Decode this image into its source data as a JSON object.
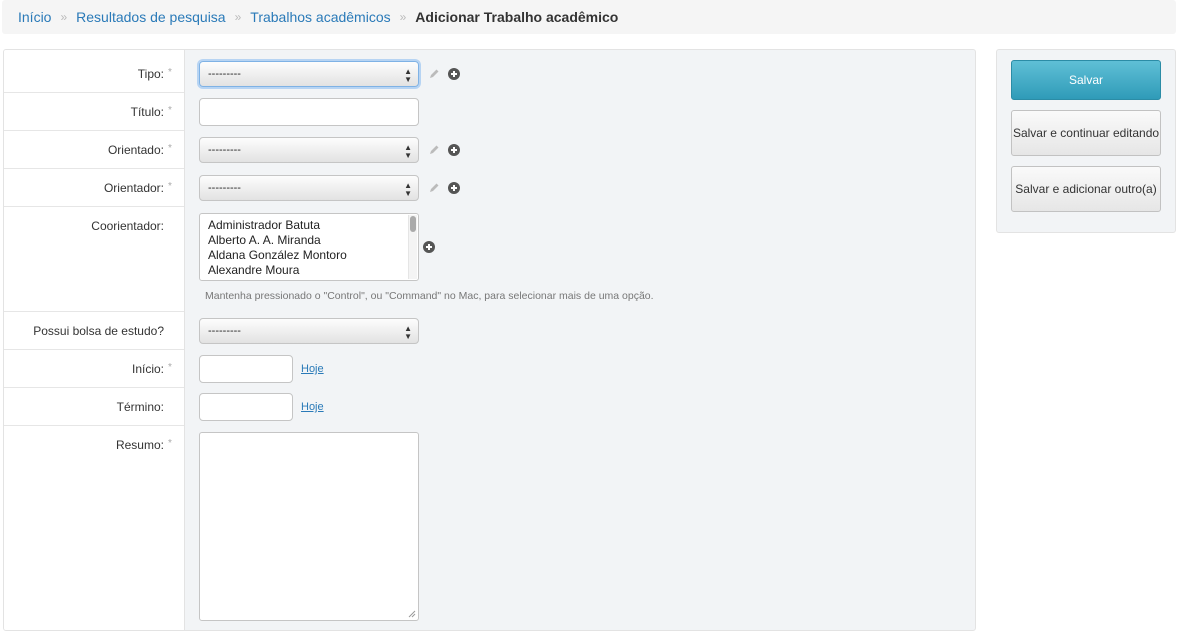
{
  "breadcrumb": {
    "items": [
      "Início",
      "Resultados de pesquisa",
      "Trabalhos acadêmicos"
    ],
    "current": "Adicionar Trabalho acadêmico",
    "separator": "»"
  },
  "form": {
    "required_mark": "*",
    "fields": {
      "tipo": {
        "label": "Tipo:",
        "value": "---------"
      },
      "titulo": {
        "label": "Título:",
        "value": ""
      },
      "orientado": {
        "label": "Orientado:",
        "value": "---------"
      },
      "orientador": {
        "label": "Orientador:",
        "value": "---------"
      },
      "coorientador": {
        "label": "Coorientador:",
        "options": [
          "Administrador Batuta",
          "Alberto A. A. Miranda",
          "Aldana González Montoro",
          "Alexandre Moura"
        ],
        "help": "Mantenha pressionado o \"Control\", ou \"Command\" no Mac, para selecionar mais de uma opção."
      },
      "bolsa": {
        "label": "Possui bolsa de estudo?",
        "value": "---------"
      },
      "inicio": {
        "label": "Início:",
        "value": "",
        "today_link": "Hoje"
      },
      "termino": {
        "label": "Término:",
        "value": "",
        "today_link": "Hoje"
      },
      "resumo": {
        "label": "Resumo:",
        "value": ""
      }
    }
  },
  "submit": {
    "save": "Salvar",
    "save_continue": "Salvar e continuar editando",
    "save_add": "Salvar e adicionar outro(a)"
  },
  "colors": {
    "link": "#2a7ab8",
    "primary_button": "#3aa7c3",
    "panel_bg": "#f2f4f6"
  }
}
